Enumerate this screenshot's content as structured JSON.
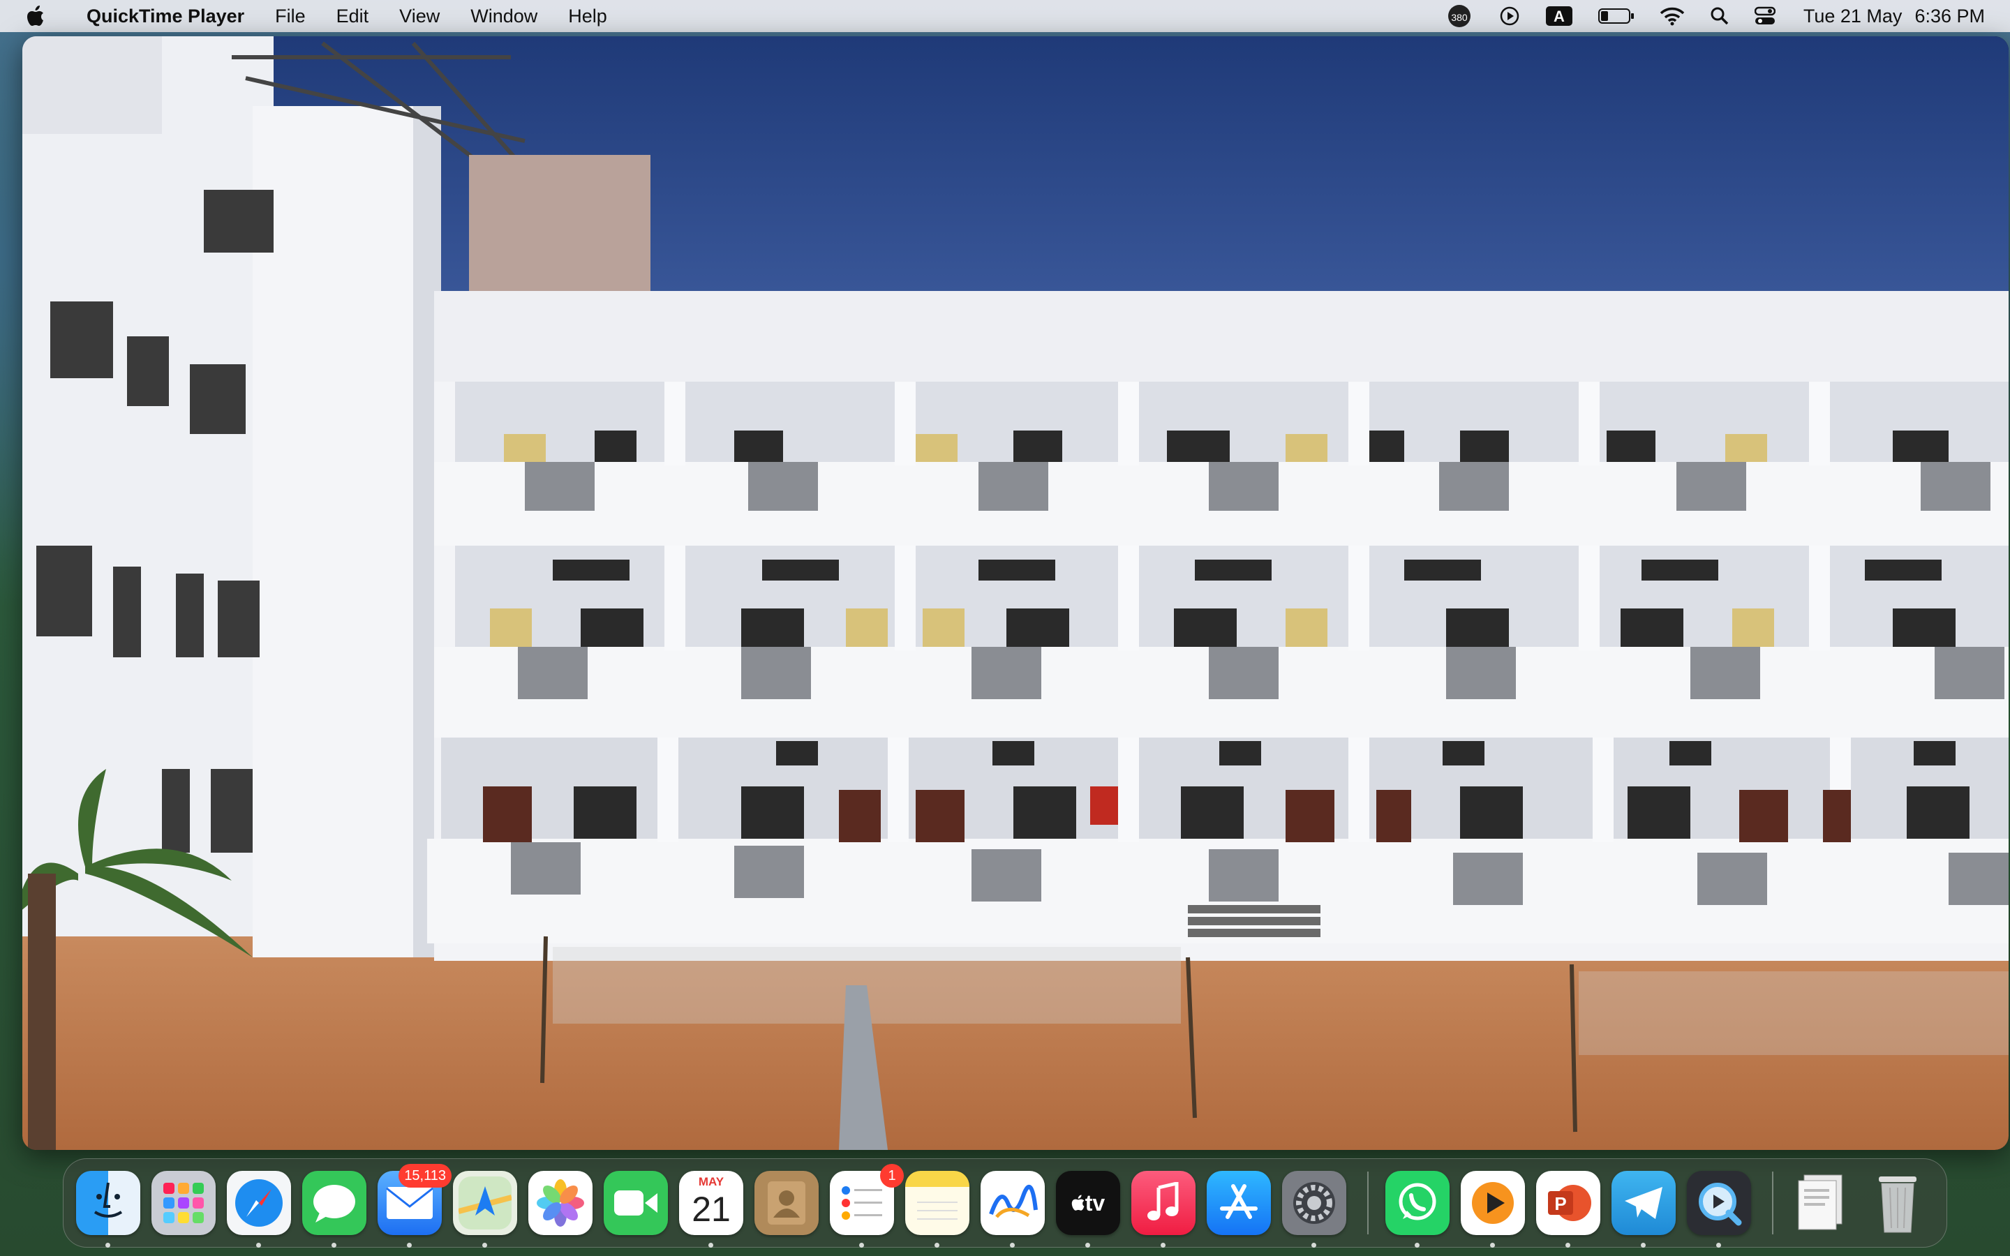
{
  "menubar": {
    "app_name": "QuickTime Player",
    "menus": [
      "File",
      "Edit",
      "View",
      "Window",
      "Help"
    ],
    "status": {
      "badge_count": "380",
      "input_source": "A",
      "date": "Tue 21 May",
      "time": "6:36 PM"
    }
  },
  "video": {
    "description_icon": "video-frame"
  },
  "dock": {
    "apps": [
      {
        "name": "Finder",
        "icon": "finder-icon"
      },
      {
        "name": "Launchpad",
        "icon": "launchpad-icon"
      },
      {
        "name": "Safari",
        "icon": "safari-icon"
      },
      {
        "name": "Messages",
        "icon": "messages-icon"
      },
      {
        "name": "Mail",
        "icon": "mail-icon",
        "badge": "15,113"
      },
      {
        "name": "Maps",
        "icon": "maps-icon"
      },
      {
        "name": "Photos",
        "icon": "photos-icon"
      },
      {
        "name": "FaceTime",
        "icon": "facetime-icon"
      },
      {
        "name": "Calendar",
        "icon": "calendar-icon",
        "month": "MAY",
        "day": "21"
      },
      {
        "name": "Contacts",
        "icon": "contacts-icon"
      },
      {
        "name": "Reminders",
        "icon": "reminders-icon",
        "badge": "1"
      },
      {
        "name": "Notes",
        "icon": "notes-icon"
      },
      {
        "name": "Freeform",
        "icon": "freeform-icon"
      },
      {
        "name": "TV",
        "icon": "tv-icon",
        "label": "tv"
      },
      {
        "name": "Music",
        "icon": "music-icon"
      },
      {
        "name": "App Store",
        "icon": "app-store-icon"
      },
      {
        "name": "System Settings",
        "icon": "settings-icon"
      },
      {
        "name": "WhatsApp",
        "icon": "whatsapp-icon"
      },
      {
        "name": "Infuse",
        "icon": "infuse-icon"
      },
      {
        "name": "PowerPoint",
        "icon": "powerpoint-icon"
      },
      {
        "name": "Telegram",
        "icon": "telegram-icon"
      },
      {
        "name": "QuickTime Player",
        "icon": "quicktime-icon"
      },
      {
        "name": "Documents",
        "icon": "documents-stack-icon"
      },
      {
        "name": "Trash",
        "icon": "trash-icon"
      }
    ]
  }
}
